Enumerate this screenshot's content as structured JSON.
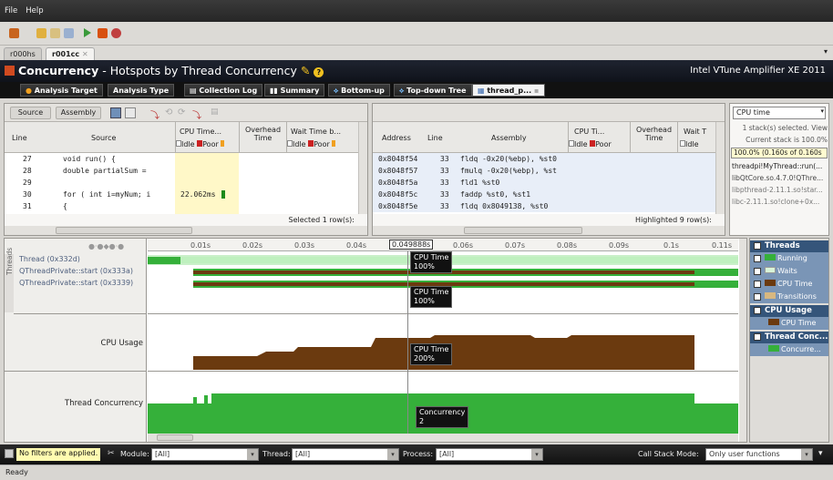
{
  "menu": [
    "File",
    "Help"
  ],
  "file_tabs": [
    "r000hs",
    "r001cc"
  ],
  "header": {
    "title_bold": "Concurrency",
    "title_rest": " - Hotspots by Thread Concurrency",
    "product": "Intel VTune Amplifier XE 2011"
  },
  "nav": [
    "Analysis Target",
    "Analysis Type",
    "Collection Log",
    "Summary",
    "Bottom-up",
    "Top-down Tree",
    "thread_p..."
  ],
  "source_pane": {
    "buttons": [
      "Source",
      "Assembly"
    ],
    "col_line": "Line",
    "col_source": "Source",
    "col_cpu": "CPU Time...",
    "col_overhead": "Overhead Time",
    "col_wait": "Wait Time b...",
    "legend_idle": "Idle",
    "legend_poor": "Poor",
    "rows": [
      {
        "line": "27",
        "src": "void run() {",
        "cpu": ""
      },
      {
        "line": "28",
        "src": "    double partialSum =",
        "cpu": ""
      },
      {
        "line": "29",
        "src": "",
        "cpu": ""
      },
      {
        "line": "30",
        "src": "    for ( int i=myNum; i",
        "cpu": "22.062ms"
      },
      {
        "line": "31",
        "src": "    {",
        "cpu": ""
      }
    ],
    "footer": "Selected 1 row(s):"
  },
  "asm_pane": {
    "col_address": "Address",
    "col_line": "Line",
    "col_assembly": "Assembly",
    "col_cpu": "CPU Ti...",
    "col_overhead": "Overhead Time",
    "col_wait": "Wait T",
    "legend_idle": "Idle",
    "legend_poor": "Poor",
    "rows": [
      {
        "addr": "0x8048f54",
        "line": "33",
        "asm": "fldq  -0x20(%ebp), %st0"
      },
      {
        "addr": "0x8048f57",
        "line": "33",
        "asm": "fmulq  -0x20(%ebp), %st"
      },
      {
        "addr": "0x8048f5a",
        "line": "33",
        "asm": "fld1 %st0"
      },
      {
        "addr": "0x8048f5c",
        "line": "33",
        "asm": "faddp %st0, %st1"
      },
      {
        "addr": "0x8048f5e",
        "line": "33",
        "asm": "fldq  0x8049138, %st0"
      }
    ],
    "footer": "Highlighted 9 row(s):"
  },
  "stack_pane": {
    "select": "CPU time",
    "info1": "1 stack(s) selected. View",
    "info2": "Current stack is 100.0%",
    "highlight": "100.0% (0.160s of 0.160s",
    "frames": [
      "threadpi!MyThread::run(...",
      "libQtCore.so.4.7.0!QThre...",
      "libpthread-2.11.1.so!star...",
      "libc-2.11.1.so!clone+0x..."
    ]
  },
  "timeline": {
    "ticks": [
      "0.01s",
      "0.02s",
      "0.03s",
      "0.04s",
      "0.049888s",
      "0.06s",
      "0.07s",
      "0.08s",
      "0.09s",
      "0.1s",
      "0.11s"
    ],
    "side_label": "Threads",
    "threads": [
      "Thread (0x332d)",
      "QThreadPrivate::start (0x333a)",
      "QThreadPrivate::start (0x3339)"
    ],
    "cpu_usage_label": "CPU Usage",
    "concurrency_label": "Thread Concurrency",
    "tooltips": [
      {
        "title": "CPU Time",
        "value": "100%"
      },
      {
        "title": "CPU Time",
        "value": "100%"
      },
      {
        "title": "CPU Time",
        "value": "200%"
      },
      {
        "title": "Concurrency",
        "value": "2"
      }
    ]
  },
  "legend": {
    "threads_head": "Threads",
    "threads_items": [
      "Running",
      "Waits",
      "CPU Time",
      "Transitions"
    ],
    "cpu_head": "CPU Usage",
    "cpu_items": [
      "CPU Time"
    ],
    "conc_head": "Thread Conc...",
    "conc_items": [
      "Concurre..."
    ]
  },
  "filters": {
    "no_filters": "No filters are applied.",
    "module_label": "Module:",
    "module_value": "[All]",
    "thread_label": "Thread:",
    "thread_value": "[All]",
    "process_label": "Process:",
    "process_value": "[All]",
    "callstack_label": "Call Stack Mode:",
    "callstack_value": "Only user functions"
  },
  "status": "Ready",
  "colors": {
    "brown": "#6b3a0f",
    "green": "#35b03a",
    "light_green": "#8fd88f",
    "header_dark": "#111111",
    "highlight_yellow": "#fff8c8"
  }
}
